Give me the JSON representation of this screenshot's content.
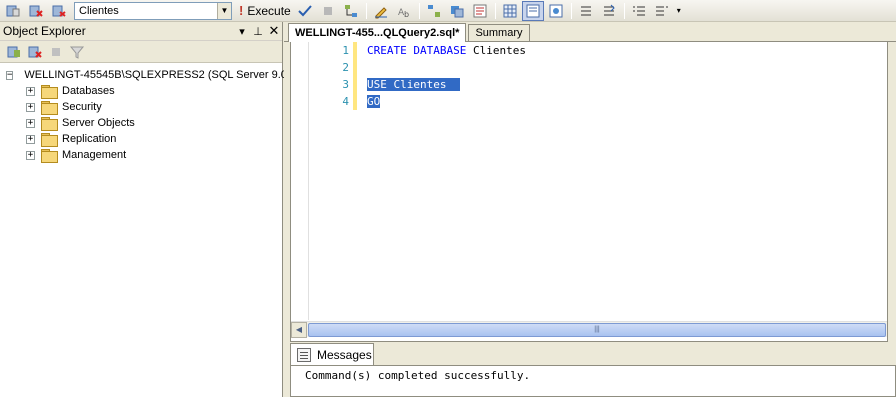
{
  "toolbar": {
    "database_selected": "Clientes",
    "execute_label": "Execute"
  },
  "object_explorer": {
    "title": "Object Explorer",
    "server_label": "WELLINGT-45545B\\SQLEXPRESS2 (SQL Server 9.0",
    "folders": [
      "Databases",
      "Security",
      "Server Objects",
      "Replication",
      "Management"
    ]
  },
  "editor": {
    "tabs": [
      "WELLINGT-455...QLQuery2.sql*",
      "Summary"
    ],
    "line_numbers": [
      "1",
      "2",
      "3",
      "4"
    ],
    "code_lines": [
      {
        "kw": "CREATE DATABASE",
        "rest": " Clientes"
      },
      {
        "kw": "",
        "rest": ""
      },
      {
        "kw": "USE",
        "rest": " Clientes"
      },
      {
        "kw": "GO",
        "rest": ""
      }
    ]
  },
  "results": {
    "tab_label": "Messages",
    "message": "Command(s) completed successfully."
  }
}
